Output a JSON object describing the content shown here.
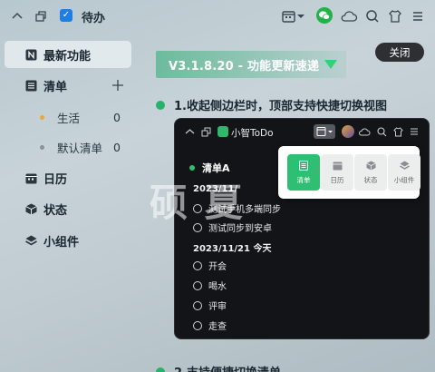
{
  "app": {
    "title": "待办"
  },
  "main": {
    "close_label": "关闭",
    "version_banner": "V3.1.8.20 - 功能更新速递",
    "feature_1": "1.收起侧边栏时，顶部支持快捷切换视图",
    "feature_2": "2.支持便捷切换清单"
  },
  "sidebar": {
    "items": [
      {
        "label": "最新功能",
        "icon": "n-badge-icon",
        "active": true
      },
      {
        "label": "清单",
        "icon": "list-icon"
      },
      {
        "label": "日历",
        "icon": "calendar-icon"
      },
      {
        "label": "状态",
        "icon": "cube-icon"
      },
      {
        "label": "小组件",
        "icon": "layers-icon"
      }
    ],
    "lists": [
      {
        "label": "生活",
        "count": "0",
        "color": "#e8a838"
      },
      {
        "label": "默认清单",
        "count": "0",
        "color": "#8a9296"
      }
    ]
  },
  "inner": {
    "app_name": "小智ToDo",
    "list_title": "清单A",
    "date_1": "2023/11/",
    "tasks_1": [
      "测试手机多端同步",
      "测试同步到安卓"
    ],
    "date_2": "2023/11/21 今天",
    "tasks_2": [
      "开会",
      "喝水",
      "评审",
      "走查"
    ],
    "view_options": [
      "清单",
      "日历",
      "状态",
      "小组件"
    ]
  },
  "watermark": "硕 夏",
  "colors": {
    "accent": "#2fbf72",
    "wechat": "#21b24b",
    "badge": "#1e7fe0"
  }
}
